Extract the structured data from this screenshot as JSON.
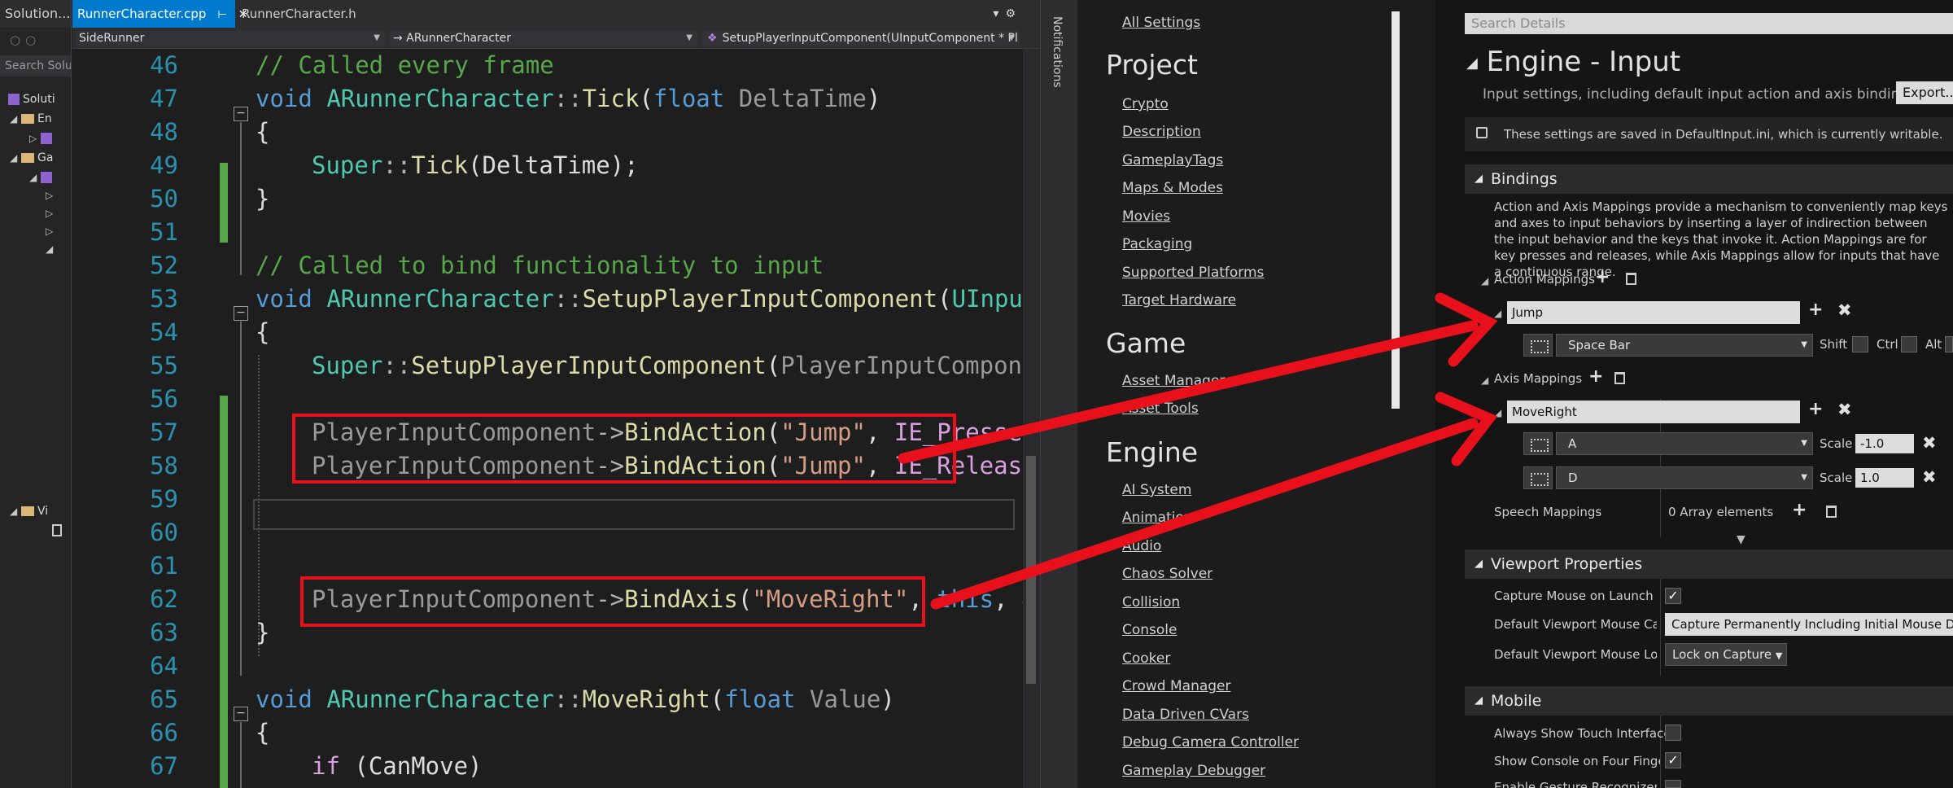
{
  "solution": {
    "title": "Solution...",
    "search": "Search Solu",
    "items": [
      "Soluti",
      "En",
      "Ga",
      "Vi"
    ]
  },
  "editor": {
    "tabs": [
      {
        "label": "RunnerCharacter.cpp",
        "active": true
      },
      {
        "label": "RunnerCharacter.h",
        "active": false
      }
    ],
    "nav": {
      "project": "SideRunner",
      "class": "→ ARunnerCharacter",
      "member": "SetupPlayerInputComponent(UInputComponent * Pl"
    },
    "line_numbers": [
      "46",
      "47",
      "48",
      "49",
      "50",
      "51",
      "52",
      "53",
      "54",
      "55",
      "56",
      "57",
      "58",
      "59",
      "60",
      "61",
      "62",
      "63",
      "64",
      "65",
      "66",
      "67"
    ],
    "code": {
      "l46": "// Called every frame",
      "l47": {
        "kw": "void",
        "cls": "ARunnerCharacter",
        "sep": "::",
        "fn": "Tick",
        "p1": "(",
        "ty": "float",
        "param": "DeltaTime",
        "p2": ")"
      },
      "l48": "{",
      "l49": {
        "cls": "Super",
        "sep": "::",
        "fn": "Tick",
        "rest": "(DeltaTime);"
      },
      "l50": "}",
      "l52": "// Called to bind functionality to input",
      "l53": {
        "kw": "void",
        "cls": "ARunnerCharacter",
        "sep": "::",
        "fn": "SetupPlayerInputComponent",
        "p1": "(",
        "ty": "UInput"
      },
      "l54": "{",
      "l55": {
        "cls": "Super",
        "sep": "::",
        "fn": "SetupPlayerInputComponent",
        "p1": "(",
        "param": "PlayerInputCompone"
      },
      "l57": {
        "obj": "PlayerInputComponent",
        "arrow": "->",
        "fn": "BindAction",
        "p1": "(",
        "str": "\"Jump\"",
        "comma": ", ",
        "tail": "IE_Pressed"
      },
      "l58": {
        "obj": "PlayerInputComponent",
        "arrow": "->",
        "fn": "BindAction",
        "p1": "(",
        "str": "\"Jump\"",
        "comma": ", ",
        "tail": "IE_Release"
      },
      "l62": {
        "obj": "PlayerInputComponent",
        "arrow": "->",
        "fn": "BindAxis",
        "p1": "(",
        "str": "\"MoveRight\"",
        "comma": ", ",
        "kw": "this",
        "tail": ", &"
      },
      "l63": "}",
      "l65": {
        "kw": "void",
        "cls": "ARunnerCharacter",
        "sep": "::",
        "fn": "MoveRight",
        "p1": "(",
        "ty": "float",
        "param": "Value",
        "p2": ")"
      },
      "l66": "{",
      "l67": {
        "ctl": "if",
        "rest": " (CanMove)"
      }
    }
  },
  "notifications_label": "Notifications",
  "settings_nav": {
    "all": "All Settings",
    "sections": [
      {
        "title": "Project",
        "items": [
          "Crypto",
          "Description",
          "GameplayTags",
          "Maps & Modes",
          "Movies",
          "Packaging",
          "Supported Platforms",
          "Target Hardware"
        ]
      },
      {
        "title": "Game",
        "items": [
          "Asset Manager",
          "Asset Tools"
        ]
      },
      {
        "title": "Engine",
        "items": [
          "AI System",
          "Animation",
          "Audio",
          "Chaos Solver",
          "Collision",
          "Console",
          "Cooker",
          "Crowd Manager",
          "Data Driven CVars",
          "Debug Camera Controller",
          "Gameplay Debugger"
        ]
      }
    ]
  },
  "details": {
    "search_placeholder": "Search Details",
    "title": "Engine - Input",
    "description": "Input settings, including default input action and axis bindings.",
    "export_label": "Export...",
    "notice": "These settings are saved in DefaultInput.ini, which is currently writable.",
    "bindings": {
      "header": "Bindings",
      "description": "Action and Axis Mappings provide a mechanism to conveniently map keys and axes to input behaviors by inserting a layer of indirection between the input behavior and the keys that invoke it. Action Mappings are for key presses and releases, while Axis Mappings allow for inputs that have a continuous range.",
      "action_label": "Action Mappings",
      "action": {
        "name": "Jump",
        "key": "Space Bar",
        "shift": "Shift",
        "ctrl": "Ctrl",
        "alt": "Alt"
      },
      "axis_label": "Axis Mappings",
      "axis": {
        "name": "MoveRight",
        "keys": [
          {
            "key": "A",
            "scale_label": "Scale",
            "scale": "-1.0"
          },
          {
            "key": "D",
            "scale_label": "Scale",
            "scale": "1.0"
          }
        ]
      },
      "speech_label": "Speech Mappings",
      "speech_value": "0 Array elements"
    },
    "viewport": {
      "header": "Viewport Properties",
      "capture_launch": "Capture Mouse on Launch",
      "capture_mode_label": "Default Viewport Mouse Capture Mode",
      "capture_mode_value": "Capture Permanently Including Initial Mouse Down",
      "lock_label": "Default Viewport Mouse Lock Mode",
      "lock_value": "Lock on Capture"
    },
    "mobile": {
      "header": "Mobile",
      "touch": "Always Show Touch Interface",
      "console": "Show Console on Four Finger Tap",
      "gesture": "Enable Gesture Recognizer"
    }
  },
  "colors": {
    "accent": "#007acc",
    "annotation_red": "#e8101a",
    "change_green": "#57a64a"
  }
}
